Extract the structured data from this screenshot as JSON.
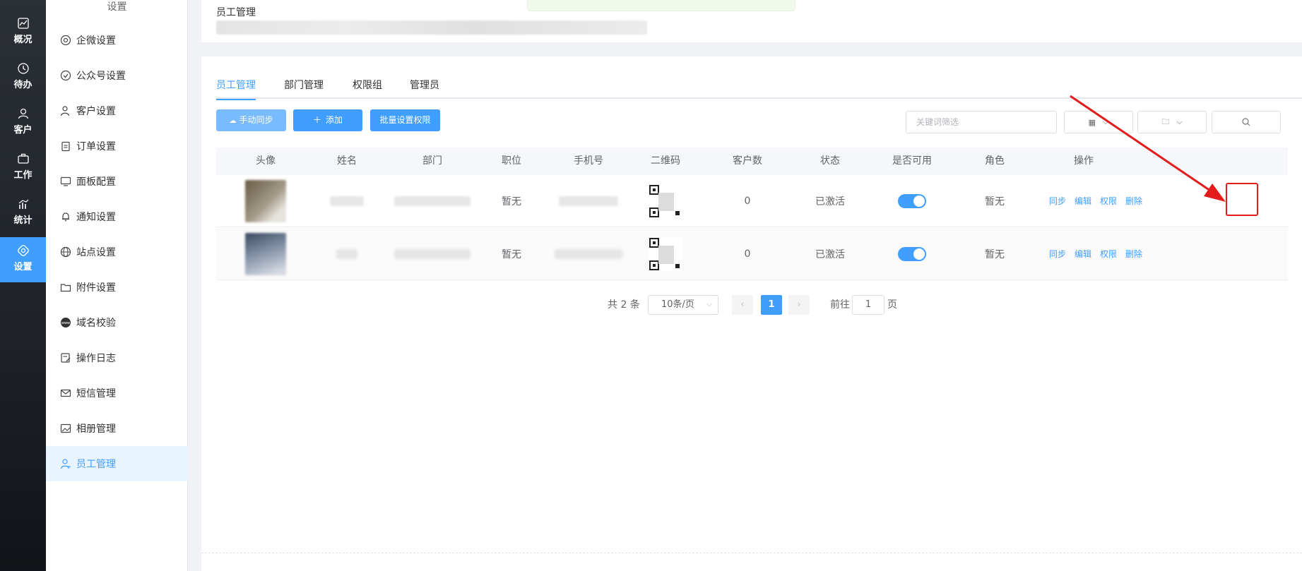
{
  "rail": {
    "items": [
      {
        "label": "概况",
        "icon": "chart-line-icon"
      },
      {
        "label": "待办",
        "icon": "clock-history-icon"
      },
      {
        "label": "客户",
        "icon": "user-icon"
      },
      {
        "label": "工作",
        "icon": "briefcase-icon"
      },
      {
        "label": "统计",
        "icon": "bar-chart-icon"
      },
      {
        "label": "设置",
        "icon": "gear-icon"
      }
    ]
  },
  "submenu": {
    "title": "设置",
    "items": [
      {
        "label": "企微设置",
        "icon": "wecom-icon"
      },
      {
        "label": "公众号设置",
        "icon": "badge-check-icon"
      },
      {
        "label": "客户设置",
        "icon": "user-settings-icon"
      },
      {
        "label": "订单设置",
        "icon": "clipboard-icon"
      },
      {
        "label": "面板配置",
        "icon": "monitor-icon"
      },
      {
        "label": "通知设置",
        "icon": "bell-icon"
      },
      {
        "label": "站点设置",
        "icon": "globe-icon"
      },
      {
        "label": "附件设置",
        "icon": "folder-icon"
      },
      {
        "label": "域名校验",
        "icon": "www-icon"
      },
      {
        "label": "操作日志",
        "icon": "edit-log-icon"
      },
      {
        "label": "短信管理",
        "icon": "mail-icon"
      },
      {
        "label": "相册管理",
        "icon": "album-icon"
      },
      {
        "label": "员工管理",
        "icon": "staff-icon"
      }
    ]
  },
  "header": {
    "title": "员工管理"
  },
  "tabs": [
    "员工管理",
    "部门管理",
    "权限组",
    "管理员"
  ],
  "toolbar": {
    "sync_label": "手动同步",
    "add_label": "添加",
    "batch_label": "批量设置权限",
    "filter_placeholder": "关键词筛选"
  },
  "table": {
    "headers": [
      "头像",
      "姓名",
      "部门",
      "职位",
      "手机号",
      "二维码",
      "客户数",
      "状态",
      "是否可用",
      "角色",
      "操作"
    ],
    "rows": [
      {
        "position": "暂无",
        "customers": "0",
        "status": "已激活",
        "role": "暂无",
        "enabled": true
      },
      {
        "position": "暂无",
        "customers": "0",
        "status": "已激活",
        "role": "暂无",
        "enabled": true
      }
    ],
    "actions": [
      "同步",
      "编辑",
      "权限",
      "删除"
    ]
  },
  "pagination": {
    "total": "共 2 条",
    "page_size": "10条/页",
    "current": "1",
    "goto_label": "前往",
    "goto_value": "1",
    "page_suffix": "页"
  },
  "colors": {
    "primary": "#409eff",
    "annotation": "#e41b1b"
  }
}
